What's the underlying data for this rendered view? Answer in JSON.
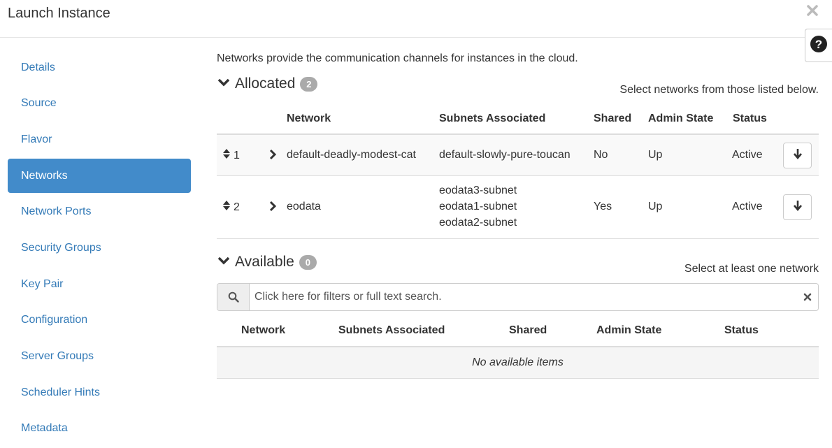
{
  "modal": {
    "title": "Launch Instance"
  },
  "sidebar": {
    "items": [
      {
        "label": "Details"
      },
      {
        "label": "Source"
      },
      {
        "label": "Flavor"
      },
      {
        "label": "Networks",
        "active": true
      },
      {
        "label": "Network Ports"
      },
      {
        "label": "Security Groups"
      },
      {
        "label": "Key Pair"
      },
      {
        "label": "Configuration"
      },
      {
        "label": "Server Groups"
      },
      {
        "label": "Scheduler Hints"
      },
      {
        "label": "Metadata"
      }
    ]
  },
  "main": {
    "intro": "Networks provide the communication channels for instances in the cloud.",
    "allocated": {
      "title": "Allocated",
      "count": "2",
      "hint": "Select networks from those listed below.",
      "columns": [
        "Network",
        "Subnets Associated",
        "Shared",
        "Admin State",
        "Status"
      ],
      "rows": [
        {
          "order": "1",
          "network": "default-deadly-modest-cat",
          "subnets": [
            "default-slowly-pure-toucan"
          ],
          "shared": "No",
          "admin_state": "Up",
          "status": "Active"
        },
        {
          "order": "2",
          "network": "eodata",
          "subnets": [
            "eodata3-subnet",
            "eodata1-subnet",
            "eodata2-subnet"
          ],
          "shared": "Yes",
          "admin_state": "Up",
          "status": "Active"
        }
      ]
    },
    "available": {
      "title": "Available",
      "count": "0",
      "hint": "Select at least one network",
      "search_placeholder": "Click here for filters or full text search.",
      "columns": [
        "Network",
        "Subnets Associated",
        "Shared",
        "Admin State",
        "Status"
      ],
      "empty_text": "No available items"
    }
  },
  "icons": {
    "close": "close-icon",
    "help": "question-circle-icon",
    "chevron_down": "chevron-down-icon",
    "chevron_right": "chevron-right-icon",
    "sort": "sort-icon",
    "arrow_down": "arrow-down-icon",
    "search": "search-icon",
    "clear": "clear-icon"
  },
  "colors": {
    "accent": "#428bca",
    "link": "#337ab7",
    "badge": "#aaaaaa"
  }
}
